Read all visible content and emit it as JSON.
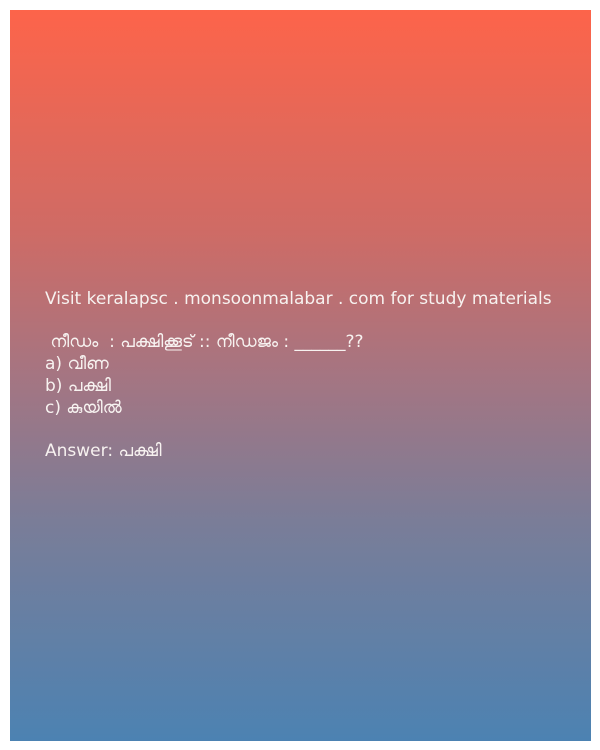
{
  "promo_text": "Visit keralapsc . monsoonmalabar . com for study materials",
  "question": " നീഡം  : പക്ഷിക്കൂട് :: നീഡജം : ______??",
  "options": [
    "a) വീണ",
    "b) പക്ഷി",
    "c) കുയിൽ"
  ],
  "answer": "Answer: പക്ഷി",
  "colors": {
    "gradient_top": "#fd644a",
    "gradient_bottom": "#4c82b2",
    "text": "#f7f2f0"
  }
}
